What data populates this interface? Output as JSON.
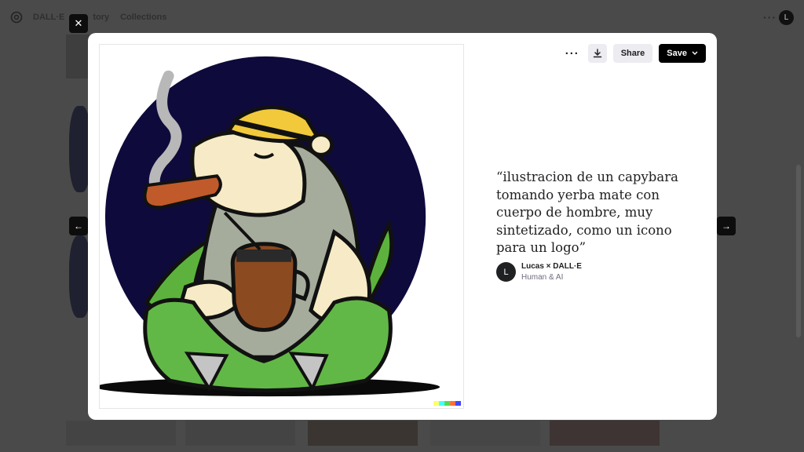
{
  "app": {
    "brand": "DALL·E",
    "nav": [
      "History",
      "Collections"
    ],
    "nav_history_partial": "tory",
    "user_initial": "L"
  },
  "modal": {
    "prompt": "“ilustracion de un capybara tomando yerba mate con cuerpo de hombre, muy sintetizado, como un icono para un logo”",
    "author_initial": "L",
    "author_name": "Lucas × DALL·E",
    "author_sub": "Human & AI",
    "share_label": "Share",
    "save_label": "Save"
  },
  "icons": {
    "close": "close-icon",
    "prev": "arrow-left-icon",
    "next": "arrow-right-icon",
    "more": "more-dots-icon",
    "download": "download-icon",
    "chevron": "chevron-down-icon"
  },
  "colors": {
    "overlay": "#4a4a4a",
    "modal_bg": "#ffffff",
    "button_dark": "#000000",
    "button_light": "#ececf1",
    "sun_circle": "#0e0a3c",
    "watermark": [
      "#ffff66",
      "#42ffff",
      "#51da4c",
      "#ff6e3c",
      "#3c46ff"
    ]
  }
}
